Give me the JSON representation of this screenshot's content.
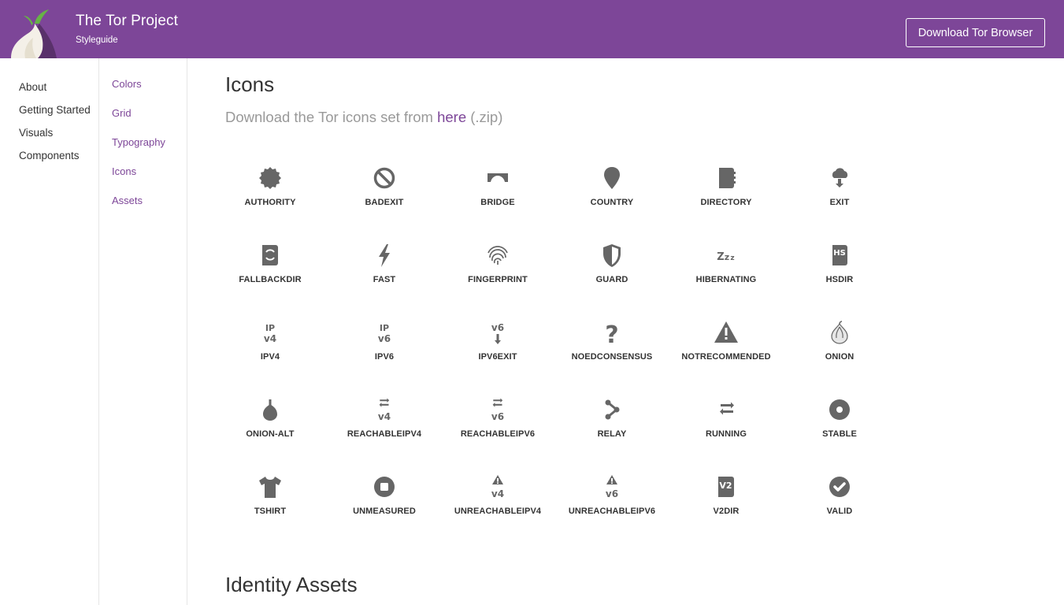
{
  "header": {
    "title": "The Tor Project",
    "subtitle": "Styleguide",
    "download_label": "Download Tor Browser",
    "bg_color": "#7d4698"
  },
  "primary_nav": [
    "About",
    "Getting Started",
    "Visuals",
    "Components"
  ],
  "secondary_nav": [
    "Colors",
    "Grid",
    "Typography",
    "Icons",
    "Assets"
  ],
  "main": {
    "title": "Icons",
    "lead_prefix": "Download the Tor icons set from ",
    "lead_link": "here",
    "lead_suffix": " (.zip)",
    "section_title": "Identity Assets"
  },
  "icons": [
    {
      "label": "AUTHORITY",
      "icon": "authority-icon"
    },
    {
      "label": "BADEXIT",
      "icon": "badexit-icon"
    },
    {
      "label": "BRIDGE",
      "icon": "bridge-icon"
    },
    {
      "label": "COUNTRY",
      "icon": "country-icon"
    },
    {
      "label": "DIRECTORY",
      "icon": "directory-icon"
    },
    {
      "label": "EXIT",
      "icon": "exit-icon"
    },
    {
      "label": "FALLBACKDIR",
      "icon": "fallbackdir-icon"
    },
    {
      "label": "FAST",
      "icon": "fast-icon"
    },
    {
      "label": "FINGERPRINT",
      "icon": "fingerprint-icon"
    },
    {
      "label": "GUARD",
      "icon": "guard-icon"
    },
    {
      "label": "HIBERNATING",
      "icon": "hibernating-icon"
    },
    {
      "label": "HSDIR",
      "icon": "hsdir-icon"
    },
    {
      "label": "IPV4",
      "icon": "ipv4-icon"
    },
    {
      "label": "IPV6",
      "icon": "ipv6-icon"
    },
    {
      "label": "IPV6EXIT",
      "icon": "ipv6exit-icon"
    },
    {
      "label": "NOEDCONSENSUS",
      "icon": "noedconsensus-icon"
    },
    {
      "label": "NOTRECOMMENDED",
      "icon": "notrecommended-icon"
    },
    {
      "label": "ONION",
      "icon": "onion-icon"
    },
    {
      "label": "ONION-ALT",
      "icon": "onion-alt-icon"
    },
    {
      "label": "REACHABLEIPV4",
      "icon": "reachableipv4-icon"
    },
    {
      "label": "REACHABLEIPV6",
      "icon": "reachableipv6-icon"
    },
    {
      "label": "RELAY",
      "icon": "relay-icon"
    },
    {
      "label": "RUNNING",
      "icon": "running-icon"
    },
    {
      "label": "STABLE",
      "icon": "stable-icon"
    },
    {
      "label": "TSHIRT",
      "icon": "tshirt-icon"
    },
    {
      "label": "UNMEASURED",
      "icon": "unmeasured-icon"
    },
    {
      "label": "UNREACHABLEIPV4",
      "icon": "unreachableipv4-icon"
    },
    {
      "label": "UNREACHABLEIPV6",
      "icon": "unreachableipv6-icon"
    },
    {
      "label": "V2DIR",
      "icon": "v2dir-icon"
    },
    {
      "label": "VALID",
      "icon": "valid-icon"
    }
  ],
  "icon_glyph_text": {
    "hibernating": "Zzz",
    "hsdir": "HS",
    "ipv4_top": "IP",
    "ipv4_bottom": "v4",
    "ipv6_top": "IP",
    "ipv6_bottom": "v6",
    "v6": "v6",
    "v4": "v4",
    "v2": "V2"
  },
  "colors": {
    "accent": "#7d4698",
    "icon": "#666666",
    "text": "#333333",
    "muted": "#999999"
  }
}
